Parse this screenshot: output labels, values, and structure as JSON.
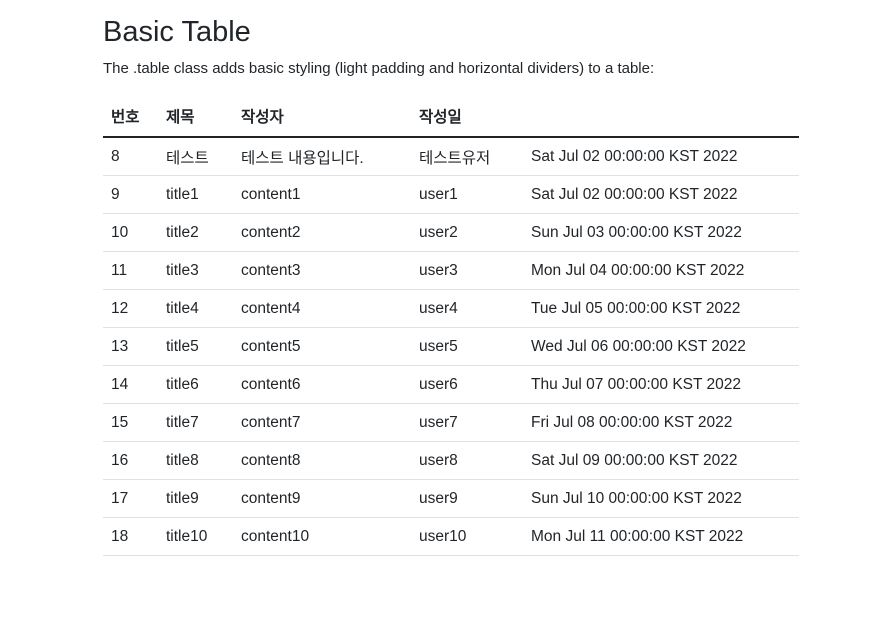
{
  "page": {
    "title": "Basic Table",
    "description": "The .table class adds basic styling (light padding and horizontal dividers) to a table:"
  },
  "table": {
    "headers": [
      "번호",
      "제목",
      "작성자",
      "작성일",
      ""
    ],
    "rows": [
      [
        "8",
        "테스트",
        "테스트 내용입니다.",
        "테스트유저",
        "Sat Jul 02 00:00:00 KST 2022"
      ],
      [
        "9",
        "title1",
        "content1",
        "user1",
        "Sat Jul 02 00:00:00 KST 2022"
      ],
      [
        "10",
        "title2",
        "content2",
        "user2",
        "Sun Jul 03 00:00:00 KST 2022"
      ],
      [
        "11",
        "title3",
        "content3",
        "user3",
        "Mon Jul 04 00:00:00 KST 2022"
      ],
      [
        "12",
        "title4",
        "content4",
        "user4",
        "Tue Jul 05 00:00:00 KST 2022"
      ],
      [
        "13",
        "title5",
        "content5",
        "user5",
        "Wed Jul 06 00:00:00 KST 2022"
      ],
      [
        "14",
        "title6",
        "content6",
        "user6",
        "Thu Jul 07 00:00:00 KST 2022"
      ],
      [
        "15",
        "title7",
        "content7",
        "user7",
        "Fri Jul 08 00:00:00 KST 2022"
      ],
      [
        "16",
        "title8",
        "content8",
        "user8",
        "Sat Jul 09 00:00:00 KST 2022"
      ],
      [
        "17",
        "title9",
        "content9",
        "user9",
        "Sun Jul 10 00:00:00 KST 2022"
      ],
      [
        "18",
        "title10",
        "content10",
        "user10",
        "Mon Jul 11 00:00:00 KST 2022"
      ]
    ]
  }
}
